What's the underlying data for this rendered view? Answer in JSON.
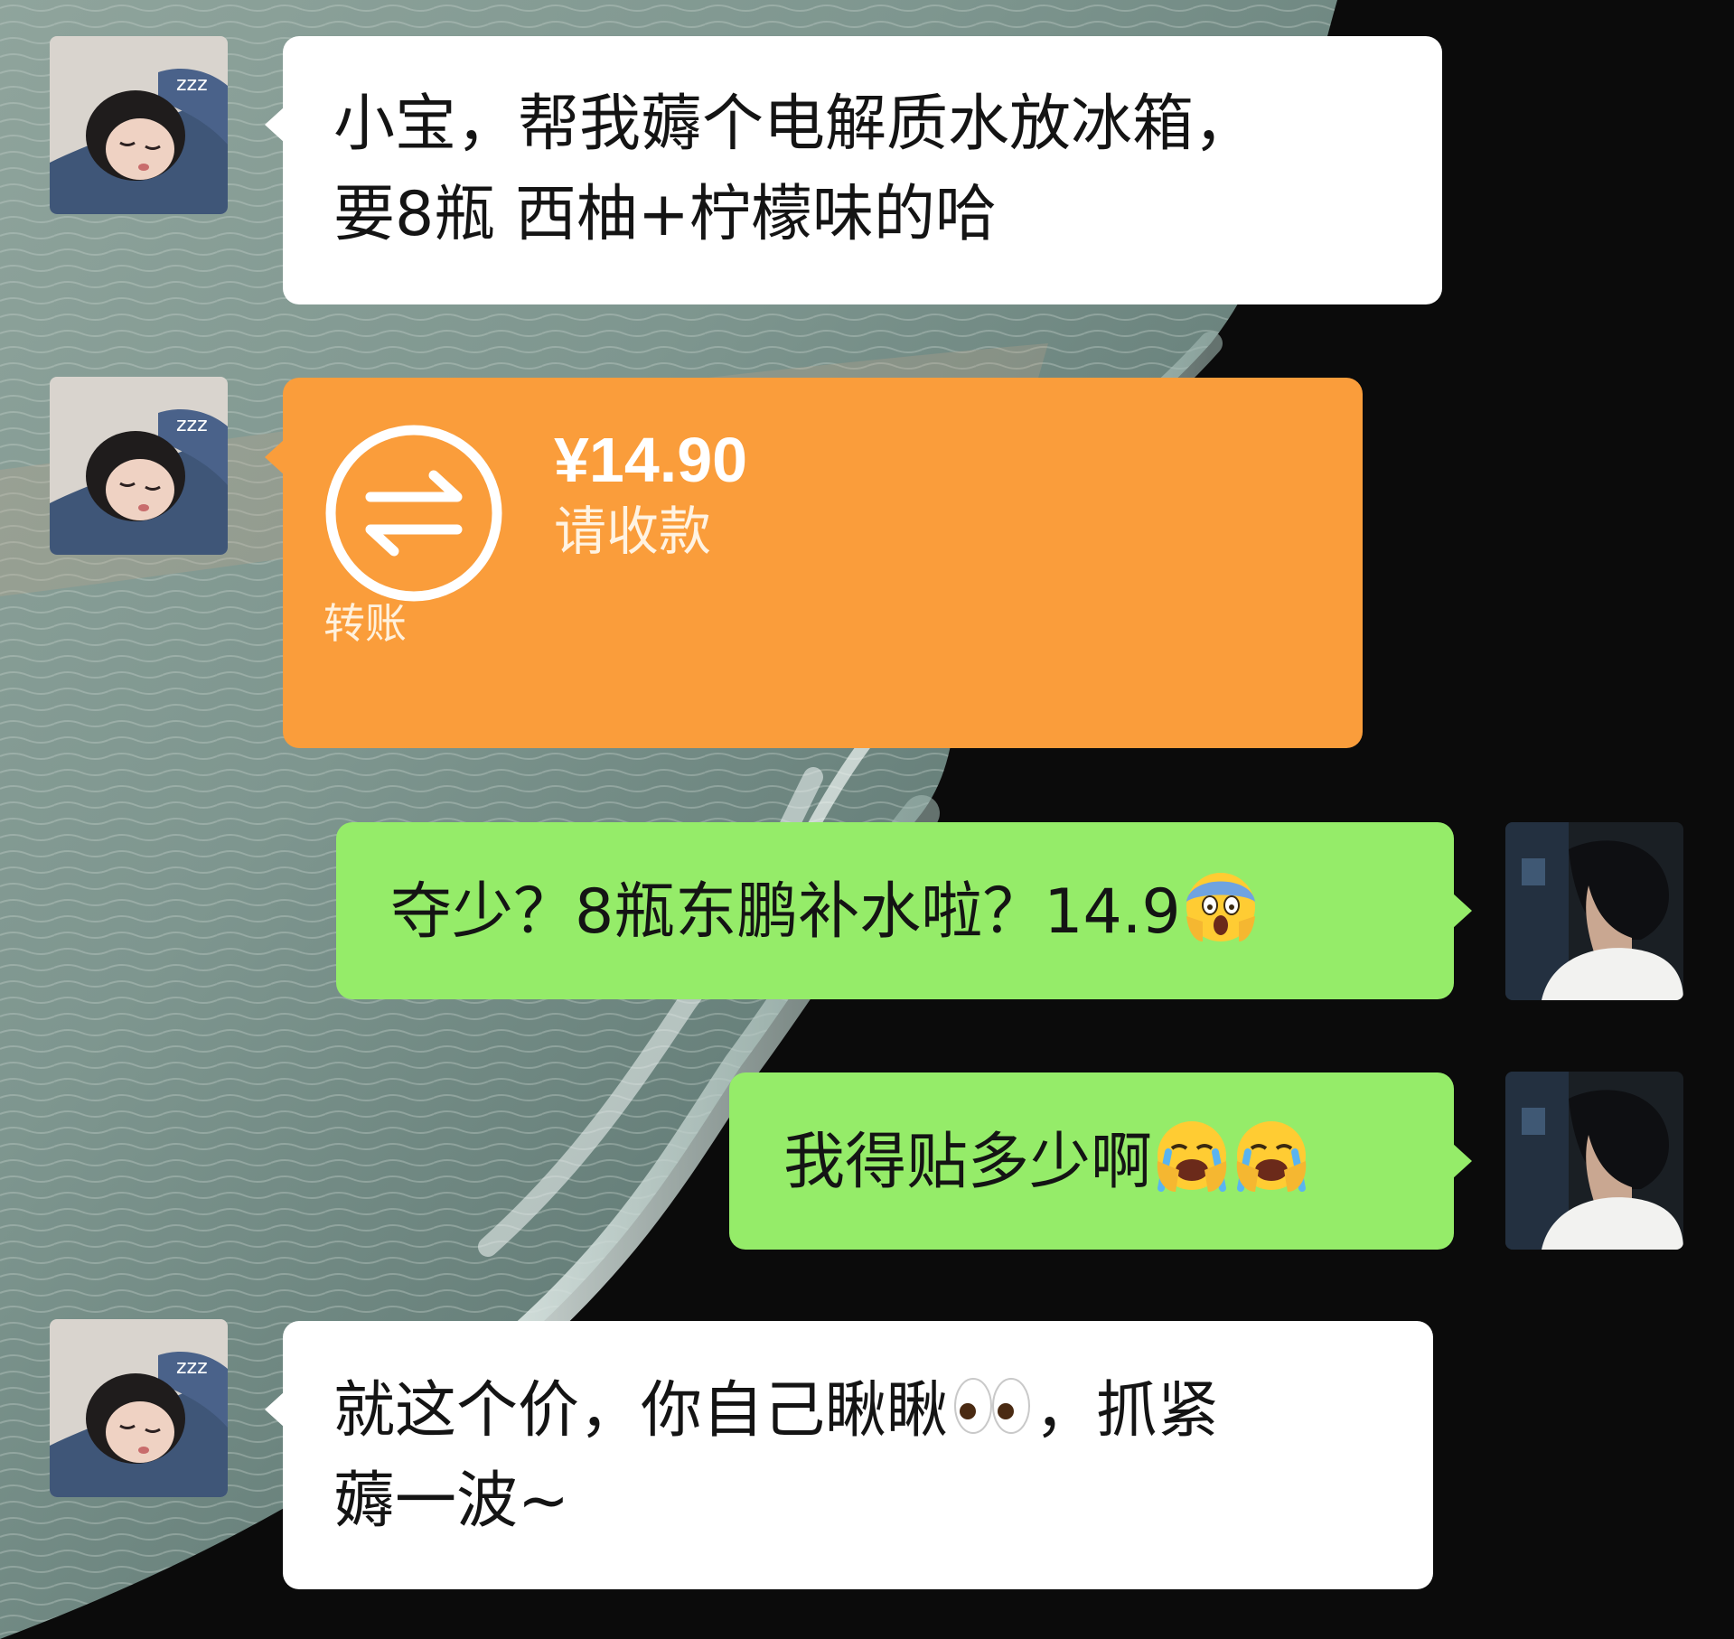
{
  "messages": [
    {
      "sender": "contact",
      "type": "text",
      "lines": [
        "小宝，帮我薅个电解质水放冰箱，",
        "要8瓶  西柚+柠檬味的哈"
      ]
    },
    {
      "sender": "contact",
      "type": "transfer",
      "amount": "¥14.90",
      "status": "请收款",
      "label": "转账",
      "icon": "transfer-arrows-icon"
    },
    {
      "sender": "me",
      "type": "text",
      "text": "夺少？8瓶东鹏补水啦？14.9",
      "emojis": [
        "face-screaming-in-fear"
      ]
    },
    {
      "sender": "me",
      "type": "text",
      "text": "我得贴多少啊",
      "emojis": [
        "loudly-crying-face",
        "loudly-crying-face"
      ]
    },
    {
      "sender": "contact",
      "type": "text",
      "line1_before": "就这个价，你自己瞅瞅",
      "line1_after": "，抓紧",
      "line2": "薅一波~",
      "emojis": [
        "eyes"
      ]
    }
  ],
  "colors": {
    "incoming_bubble": "#ffffff",
    "outgoing_bubble": "#95ec69",
    "transfer_card": "#fa9d3b",
    "text": "#141414"
  }
}
